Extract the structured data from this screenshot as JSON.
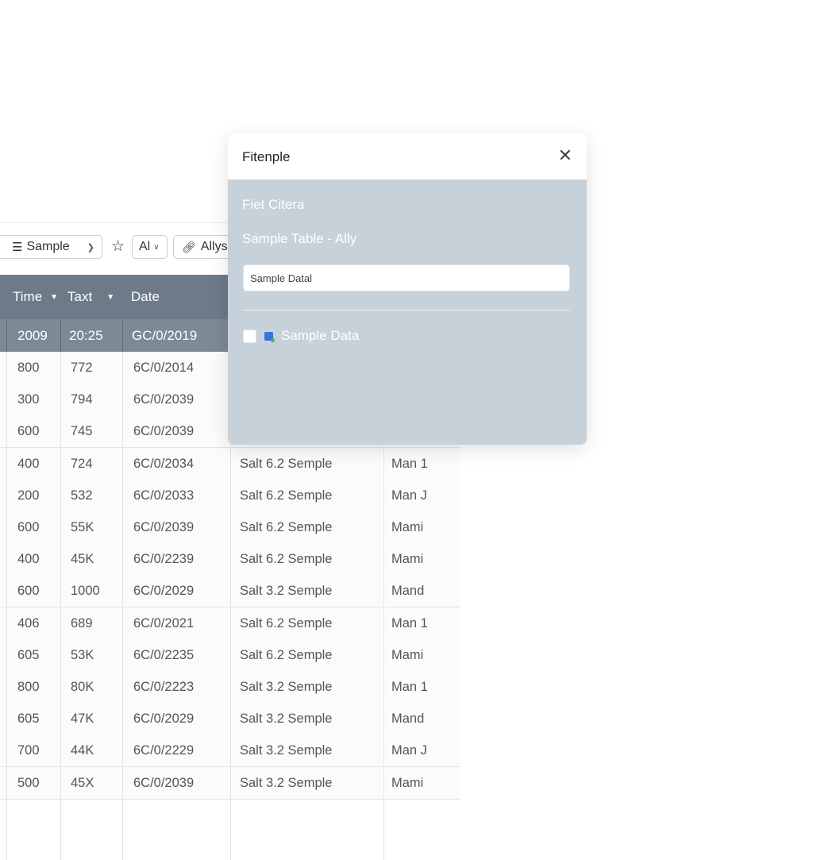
{
  "toolbar": {
    "sample_label": "Sample",
    "all_label": "Al",
    "ally_label": "Allys"
  },
  "table": {
    "headers": [
      "Time",
      "Taxt",
      "Date"
    ],
    "highlight_row": [
      "2009",
      "20:25",
      "GC/0/2019"
    ],
    "rows": [
      [
        "800",
        "772",
        "6C/0/2014",
        "",
        ""
      ],
      [
        "300",
        "794",
        "6C/0/2039",
        "",
        ""
      ],
      [
        "600",
        "745",
        "6C/0/2039",
        "",
        ""
      ],
      [
        "400",
        "724",
        "6C/0/2034",
        "Salt 6.2 Semple",
        "Man 1"
      ],
      [
        "200",
        "532",
        "6C/0/2033",
        "Salt 6.2 Semple",
        "Man J"
      ],
      [
        "600",
        "55K",
        "6C/0/2039",
        "Salt 6.2 Semple",
        "Mami"
      ],
      [
        "400",
        "45K",
        "6C/0/2239",
        "Salt 6.2 Semple",
        "Mami"
      ],
      [
        "600",
        "1000",
        "6C/0/2029",
        "Salt 3.2 Semple",
        "Mand"
      ],
      [
        "406",
        "689",
        "6C/0/2021",
        "Salt 6.2 Semple",
        "Man 1"
      ],
      [
        "605",
        "53K",
        "6C/0/2235",
        "Salt 6.2 Semple",
        "Mami"
      ],
      [
        "800",
        "80K",
        "6C/0/2223",
        "Salt 3.2 Semple",
        "Man 1"
      ],
      [
        "605",
        "47K",
        "6C/0/2029",
        "Salt 3.2 Semple",
        "Mand"
      ],
      [
        "700",
        "44K",
        "6C/0/2229",
        "Salt 3.2 Semple",
        "Man J"
      ],
      [
        "500",
        "45X",
        "6C/0/2039",
        "Salt 3.2 Semple",
        "Mami"
      ]
    ]
  },
  "dialog": {
    "title": "Fitenple",
    "criteria_label": "Fiet Citera",
    "table_label": "Sample Table - Ally",
    "search_placeholder": "Sample Datal",
    "option_label": "Sample Data"
  },
  "icons": {
    "close": "close-icon",
    "star": "star-icon",
    "menu": "menu-icon",
    "link": "link-icon",
    "caret": "caret-down-icon",
    "database": "database-icon"
  }
}
